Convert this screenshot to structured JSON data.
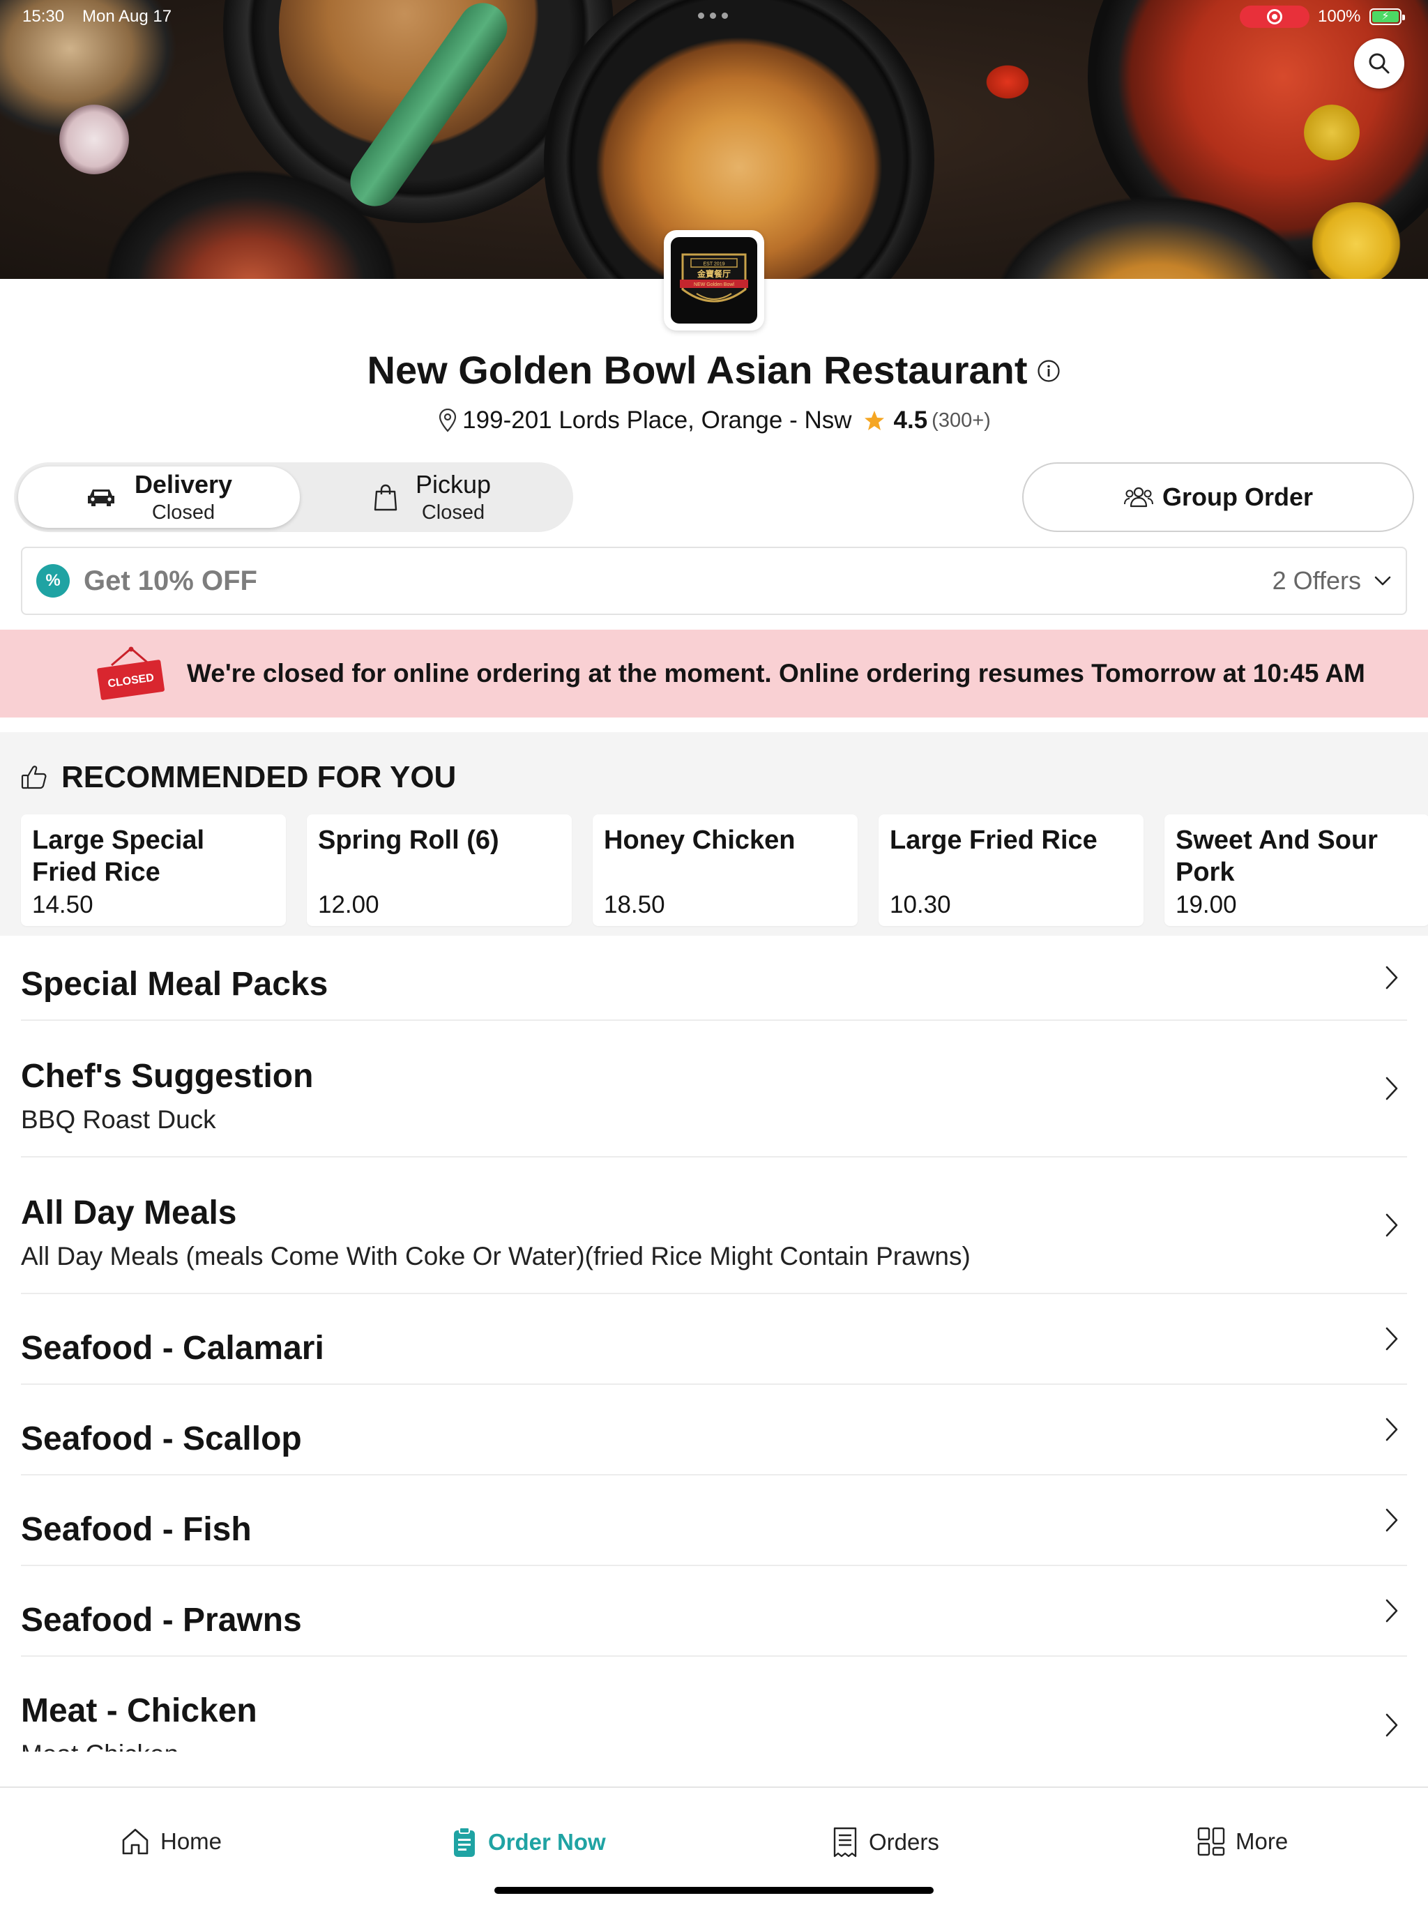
{
  "status_bar": {
    "time": "15:30",
    "date": "Mon Aug 17",
    "battery": "100%"
  },
  "restaurant": {
    "name": "New Golden Bowl Asian Restaurant",
    "address": "199-201 Lords Place, Orange - Nsw",
    "rating": "4.5",
    "rating_count": "(300+)",
    "logo_text_top": "EST 2019",
    "logo_text_main": "金寶餐厅",
    "logo_text_sub": "NEW Golden Bowl"
  },
  "order_modes": [
    {
      "label": "Delivery",
      "status": "Closed"
    },
    {
      "label": "Pickup",
      "status": "Closed"
    }
  ],
  "group_order_label": "Group Order",
  "offers": {
    "headline": "Get 10% OFF",
    "count": "2 Offers",
    "badge_symbol": "%"
  },
  "closed_banner": {
    "sign_text": "CLOSED",
    "message": "We're closed for online ordering at the moment. Online ordering resumes Tomorrow at 10:45 AM"
  },
  "recommended": {
    "heading": "RECOMMENDED FOR YOU",
    "items": [
      {
        "name": "Large Special Fried Rice",
        "price": "14.50"
      },
      {
        "name": "Spring Roll (6)",
        "price": "12.00"
      },
      {
        "name": "Honey Chicken",
        "price": "18.50"
      },
      {
        "name": "Large Fried Rice",
        "price": "10.30"
      },
      {
        "name": "Sweet And Sour Pork",
        "price": "19.00"
      }
    ]
  },
  "categories": [
    {
      "title": "Special Meal Packs",
      "desc": ""
    },
    {
      "title": "Chef's Suggestion",
      "desc": "BBQ Roast Duck"
    },
    {
      "title": "All Day Meals",
      "desc": "All Day Meals (meals Come With Coke Or Water)(fried Rice Might Contain Prawns)"
    },
    {
      "title": "Seafood - Calamari",
      "desc": ""
    },
    {
      "title": "Seafood - Scallop",
      "desc": ""
    },
    {
      "title": "Seafood - Fish",
      "desc": ""
    },
    {
      "title": "Seafood - Prawns",
      "desc": ""
    },
    {
      "title": "Meat - Chicken",
      "desc": "Meat Chicken"
    }
  ],
  "tabs": [
    {
      "label": "Home",
      "icon": "home-icon"
    },
    {
      "label": "Order Now",
      "icon": "order-icon"
    },
    {
      "label": "Orders",
      "icon": "receipt-icon"
    },
    {
      "label": "More",
      "icon": "grid-icon"
    }
  ],
  "colors": {
    "accent": "#1fa3a3",
    "closed_banner": "#f9d0d3",
    "rating_star": "#f5a623",
    "closed_sign": "#d9262f"
  }
}
